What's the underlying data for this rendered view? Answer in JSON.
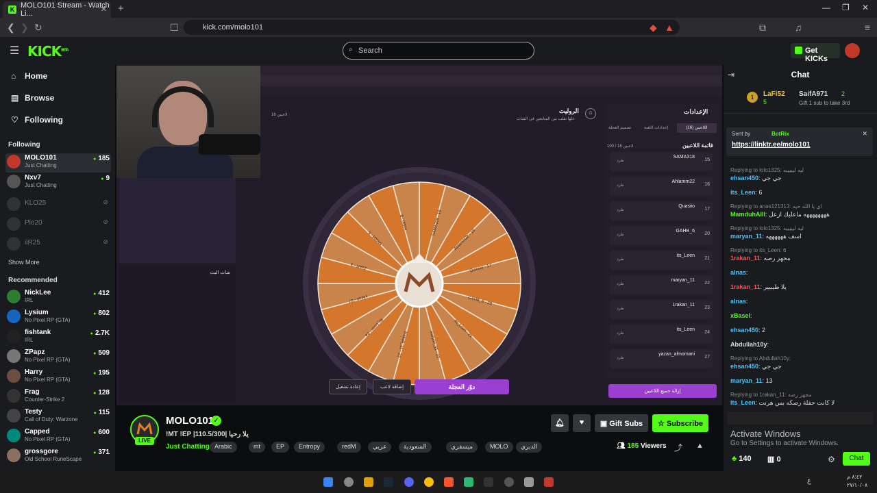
{
  "browser": {
    "tab_title": "MOLO101 Stream - Watch Li...",
    "tab_fav": "K",
    "tab_close": "✕",
    "new_tab": "+",
    "url": "kick.com/molo101",
    "win_min": "—",
    "win_max": "❐",
    "win_close": "✕"
  },
  "header": {
    "logo": "KICK",
    "logo_sup": "BETA",
    "search_placeholder": "Search",
    "get_kicks": "Get KICKs"
  },
  "sidebar": {
    "nav": [
      {
        "label": "Home",
        "icon": "⌂"
      },
      {
        "label": "Browse",
        "icon": "▤"
      },
      {
        "label": "Following",
        "icon": "♡"
      }
    ],
    "following_title": "Following",
    "following": [
      {
        "name": "MOLO101",
        "game": "Just Chatting",
        "viewers": "185",
        "color": "#c0392b"
      },
      {
        "name": "Nxv7",
        "game": "Just Chatting",
        "viewers": "9",
        "color": "#444"
      },
      {
        "name": "KLO25",
        "game": "",
        "viewers": "",
        "color": "#555"
      },
      {
        "name": "Plo20",
        "game": "",
        "viewers": "",
        "color": "#555"
      },
      {
        "name": "iiR25",
        "game": "",
        "viewers": "",
        "color": "#555"
      }
    ],
    "show_more": "Show More",
    "recommended_title": "Recommended",
    "recommended": [
      {
        "name": "NickLee",
        "game": "IRL",
        "viewers": "412",
        "color": "#2e7d32"
      },
      {
        "name": "Lysium",
        "game": "No Pixel RP (GTA)",
        "viewers": "802",
        "color": "#1565c0"
      },
      {
        "name": "fishtank",
        "game": "IRL",
        "viewers": "2.7K",
        "color": "#222"
      },
      {
        "name": "ZPapz",
        "game": "No Pixel RP (GTA)",
        "viewers": "509",
        "color": "#777"
      },
      {
        "name": "Harry",
        "game": "No Pixel RP (GTA)",
        "viewers": "195",
        "color": "#6d4c41"
      },
      {
        "name": "Frag",
        "game": "Counter-Strike 2",
        "viewers": "128",
        "color": "#333"
      },
      {
        "name": "Testy",
        "game": "Call of Duty: Warzone",
        "viewers": "115",
        "color": "#444"
      },
      {
        "name": "Capped",
        "game": "No Pixel RP (GTA)",
        "viewers": "600",
        "color": "#00897b"
      },
      {
        "name": "grossgore",
        "game": "Old School RuneScape",
        "viewers": "371",
        "color": "#8d6e63"
      }
    ]
  },
  "overlay": {
    "roulette_title": "الروليت",
    "roulette_sub": "خلها تقلب بين المتابعين في الشات",
    "player_count": "16 لاعبين",
    "settings_title": "الإعدادات",
    "settings_tabs": [
      "اللاعبين (16)",
      "إعدادات اللعبة",
      "تصميم العجلة"
    ],
    "players_title": "قائمة اللاعبين",
    "players_count": "100 / 16 لاعبين",
    "kick_label": "طرد",
    "players": [
      {
        "name": "SAMA318",
        "idx": "15"
      },
      {
        "name": "Ahlamm22",
        "idx": "16"
      },
      {
        "name": "Quasiio",
        "idx": "17"
      },
      {
        "name": "GAHB_6",
        "idx": "20"
      },
      {
        "name": "its_Leen",
        "idx": "21"
      },
      {
        "name": "maryan_11",
        "idx": "22"
      },
      {
        "name": "1rakan_11",
        "idx": "23"
      },
      {
        "name": "its_Leen",
        "idx": "24"
      },
      {
        "name": "yazan_almomani",
        "idx": "27"
      }
    ],
    "spin_button": "دوّر العجلة",
    "add_player": "إضافة لاعب",
    "restart": "إعادة تشغيل",
    "remove_all": "إزالة جميع اللاعبين",
    "chat_label": "شات البث",
    "wheel_labels": [
      "SAMA318 - 15",
      "Ahlamm22 - 16",
      "Quasiio - 17",
      "GAHB_6 - 20",
      "its_Leen - 21",
      "maryan_11 - 22",
      "1rakan_11 - 23",
      "its_Leen - 24",
      "yazan - 27",
      "ZzAR - 3",
      "Sh00d - 5",
      "nolan - 8"
    ]
  },
  "stream": {
    "channel": "MOLO101",
    "live": "LIVE",
    "title": "!MT !EP |110.5/300| يلا رحيا",
    "category": "Just Chatting",
    "tags": [
      "Arabic",
      "mt",
      "EP",
      "Entropy",
      "redM",
      "عربي",
      "السعودية",
      "ميسفري",
      "MOLO",
      "الدبري"
    ],
    "gift_subs": "Gift Subs",
    "subscribe": "Subscribe",
    "viewers": "185",
    "viewers_label": "Viewers"
  },
  "chat": {
    "title": "Chat",
    "top_gifters": [
      {
        "name": "LaFi52",
        "count": "5"
      },
      {
        "name": "SaifA971",
        "count": "2"
      }
    ],
    "gift_note": "Gift 1 sub to take 3rd",
    "pinned_by": "Sent by",
    "pinned_user": "BotRix",
    "pinned_link": "https://linktr.ee/molo101",
    "messages": [
      {
        "reply": "Replying to lolo1325: ليه ليييييه",
        "user": "ehsan450",
        "color": "#4fc3f7",
        "text": "جي جي"
      },
      {
        "reply": "",
        "user": "its_Leen",
        "color": "#4fc3f7",
        "text": "6"
      },
      {
        "reply": "Replying to anas121313: اي يا الله حيه",
        "user": "MamduhAlll",
        "color": "#53fc18",
        "text": "ههههههههه ماعليك ازعل"
      },
      {
        "reply": "Replying to lolo1325: ليه ليييييه",
        "user": "maryan_11",
        "color": "#4fc3f7",
        "text": "اسف ههههههه"
      },
      {
        "reply": "Replying to its_Leen: 6",
        "user": "1rakan_11",
        "color": "#ff5252",
        "text": "مجهز رصه"
      },
      {
        "reply": "",
        "user": "alnas",
        "color": "#4fc3f7",
        "text": ""
      },
      {
        "reply": "",
        "user": "1rakan_11",
        "color": "#ff5252",
        "text": "يلا طيبيير"
      },
      {
        "reply": "",
        "user": "alnas",
        "color": "#4fc3f7",
        "text": ""
      },
      {
        "reply": "",
        "user": "xBasel",
        "color": "#53fc18",
        "text": ""
      },
      {
        "reply": "",
        "user": "ehsan450",
        "color": "#4fc3f7",
        "text": "2"
      },
      {
        "reply": "",
        "user": "Abdullah10y",
        "color": "#ddd",
        "text": ""
      },
      {
        "reply": "Replying to Abdullah10y:",
        "user": "ehsan450",
        "color": "#4fc3f7",
        "text": "جي جي"
      },
      {
        "reply": "",
        "user": "maryan_11",
        "color": "#4fc3f7",
        "text": "13"
      },
      {
        "reply": "Replying to 1rakan_11: مجهز رصه",
        "user": "its_Leen",
        "color": "#4fc3f7",
        "text": "لا كانت حفلة رصكه بس هرنت"
      }
    ],
    "points": "140",
    "points2": "0",
    "send": "Chat",
    "activate_title": "Activate Windows",
    "activate_sub": "Go to Settings to activate Windows."
  },
  "taskbar": {
    "time": "٨:٤٢ م",
    "date": "٢٧/١٠/٠٨",
    "lang": "ع"
  }
}
